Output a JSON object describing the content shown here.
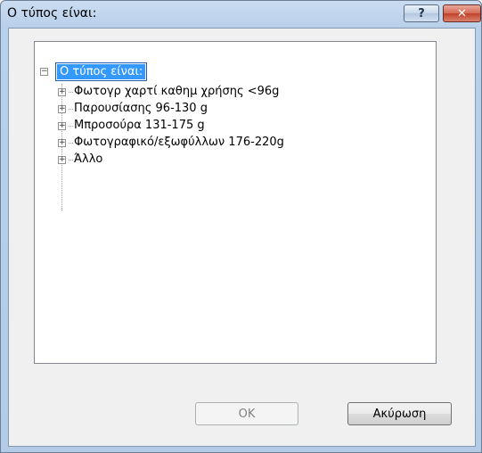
{
  "window": {
    "title": "Ο τύπος είναι:",
    "help_glyph": "?",
    "close_glyph": "✕"
  },
  "tree": {
    "root": {
      "label": "Ο τύπος είναι:",
      "expanded": true,
      "selected": true
    },
    "children": [
      {
        "label": "Φωτογρ χαρτί καθημ χρήσης <96g",
        "expanded": false
      },
      {
        "label": "Παρουσίασης 96-130 g",
        "expanded": false
      },
      {
        "label": "Μπροσούρα 131-175 g",
        "expanded": false
      },
      {
        "label": "Φωτογραφικό/εξωφύλλων 176-220g",
        "expanded": false
      },
      {
        "label": "Άλλο",
        "expanded": false
      }
    ]
  },
  "buttons": {
    "ok": "OK",
    "cancel": "Ακύρωση"
  },
  "colors": {
    "selection": "#3399ff",
    "titlebar": "#b9d0ea",
    "close": "#c1412b"
  },
  "icons": {
    "collapse": "minus-box",
    "expand": "plus-box"
  }
}
